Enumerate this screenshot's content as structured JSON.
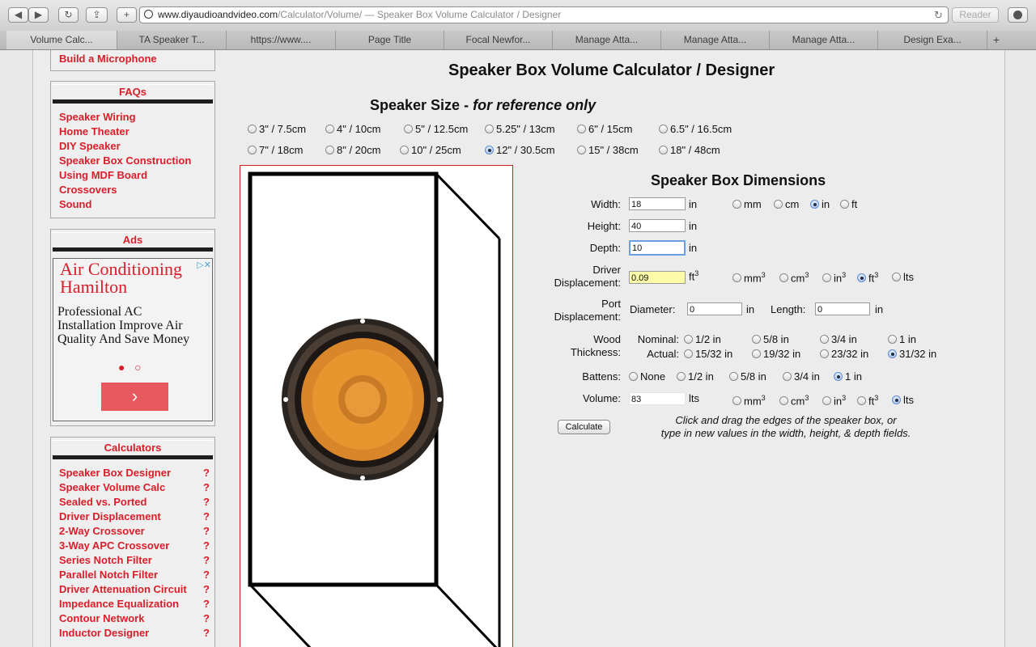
{
  "browser": {
    "url_host": "www.diyaudioandvideo.com",
    "url_path": "/Calculator/Volume/",
    "page_title_in_url": " — Speaker Box Volume Calculator / Designer",
    "reader_label": "Reader",
    "tabs": [
      "Volume Calc...",
      "TA Speaker T...",
      "https://www....",
      "Page Title",
      "Focal Newfor...",
      "Manage Atta...",
      "Manage Atta...",
      "Manage Atta...",
      "Design Exa..."
    ]
  },
  "sidebar": {
    "top_link": "Build a Microphone",
    "faqs": {
      "heading": "FAQs",
      "items": [
        "Speaker Wiring",
        "Home Theater",
        "DIY Speaker",
        "Speaker Box Construction",
        "Using MDF Board",
        "Crossovers",
        "Sound"
      ]
    },
    "ads": {
      "heading": "Ads",
      "ad_title": "Air Conditioning Hamilton",
      "ad_text": "Professional AC Installation Improve Air Quality And Save Money"
    },
    "calculators": {
      "heading": "Calculators",
      "items": [
        "Speaker Box Designer",
        "Speaker Volume Calc",
        "Sealed vs. Ported",
        "Driver Displacement",
        "2-Way Crossover",
        "3-Way APC Crossover",
        "Series Notch Filter",
        "Parallel Notch Filter",
        "Driver Attenuation Circuit",
        "Impedance Equalization",
        "Contour Network",
        "Inductor Designer"
      ],
      "help": "?"
    }
  },
  "main": {
    "title": "Speaker Box Volume Calculator / Designer",
    "speaker_size_heading": "Speaker Size - ",
    "speaker_size_note": "for reference only",
    "speaker_sizes": [
      "3\" / 7.5cm",
      "4\" / 10cm",
      "5\" / 12.5cm",
      "5.25\" / 13cm",
      "6\" / 15cm",
      "6.5\" / 16.5cm",
      "7\" / 18cm",
      "8\" / 20cm",
      "10\" / 25cm",
      "12\" / 30.5cm",
      "15\" / 38cm",
      "18\" / 48cm"
    ],
    "speaker_size_selected": "12\" / 30.5cm",
    "dims_heading": "Speaker Box Dimensions",
    "width_label": "Width:",
    "width_value": "18",
    "height_label": "Height:",
    "height_value": "40",
    "depth_label": "Depth:",
    "depth_value": "10",
    "in_unit": "in",
    "length_units": [
      "mm",
      "cm",
      "in",
      "ft"
    ],
    "length_unit_selected": "in",
    "driver_label_1": "Driver",
    "driver_label_2": "Displacement:",
    "driver_value": "0.09",
    "driver_unit": "ft",
    "volume_units": [
      "mm",
      "cm",
      "in",
      "ft",
      "lts"
    ],
    "driver_unit_selected": "ft",
    "port_label_1": "Port",
    "port_label_2": "Displacement:",
    "diameter_label": "Diameter:",
    "diameter_value": "0",
    "length_label": "Length:",
    "length_value": "0",
    "wood_label_1": "Wood",
    "wood_label_2": "Thickness:",
    "nominal_label": "Nominal:",
    "actual_label": "Actual:",
    "nominal_opts": [
      "1/2 in",
      "5/8 in",
      "3/4 in",
      "1 in"
    ],
    "actual_opts": [
      "15/32 in",
      "19/32 in",
      "23/32 in",
      "31/32 in"
    ],
    "actual_selected": "31/32 in",
    "battens_label": "Battens:",
    "battens_opts": [
      "None",
      "1/2 in",
      "5/8 in",
      "3/4 in",
      "1 in"
    ],
    "battens_selected": "1 in",
    "volume_label": "Volume:",
    "volume_value": "83",
    "volume_unit": "lts",
    "volume_unit_selected": "lts",
    "calculate_label": "Calculate",
    "hint_1": "Click and drag the edges of the speaker box, or",
    "hint_2": "type in new values in the width, height, & depth fields."
  }
}
